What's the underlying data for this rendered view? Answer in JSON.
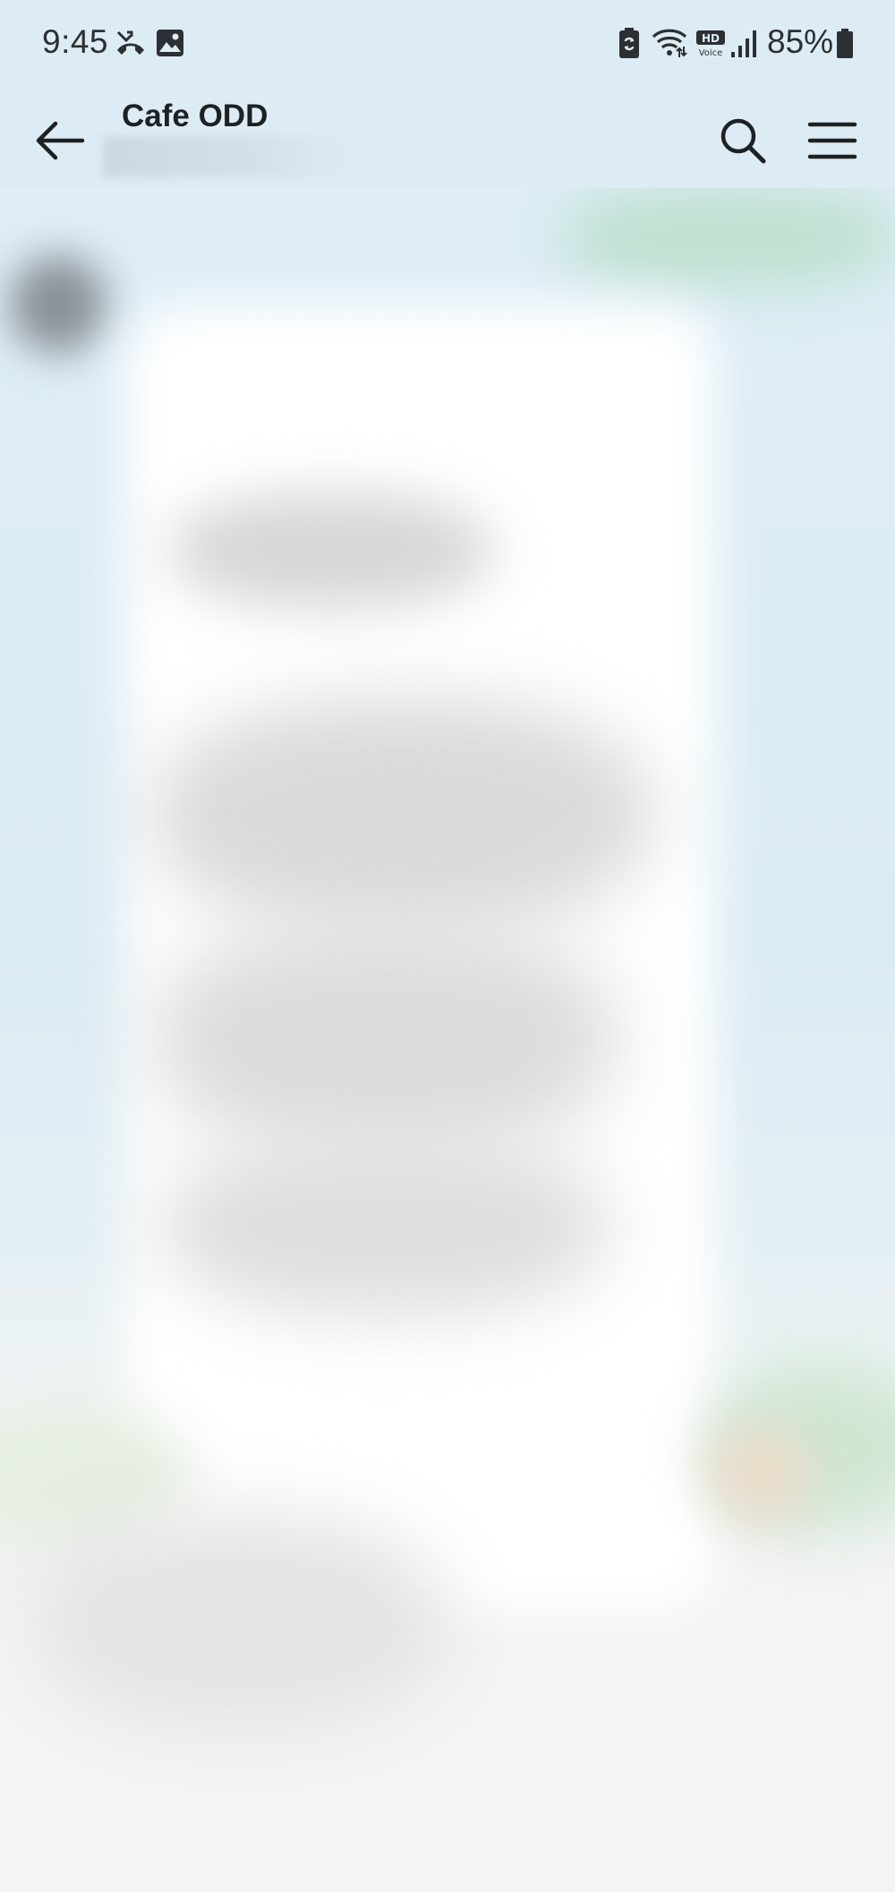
{
  "status_bar": {
    "time": "9:45",
    "battery_percent": "85%",
    "left_icons": [
      "missed-call-icon",
      "gallery-icon"
    ],
    "right_icons": [
      "battery-saver-icon",
      "wifi-icon",
      "hd-voice-icon",
      "signal-icon",
      "battery-icon"
    ]
  },
  "app_bar": {
    "title": "Cafe ODD",
    "icons": [
      "back-arrow-icon",
      "search-icon",
      "menu-icon"
    ]
  },
  "colors": {
    "background": "#dfedf5",
    "bubble": "#ffffff",
    "text": "#1e2124"
  }
}
